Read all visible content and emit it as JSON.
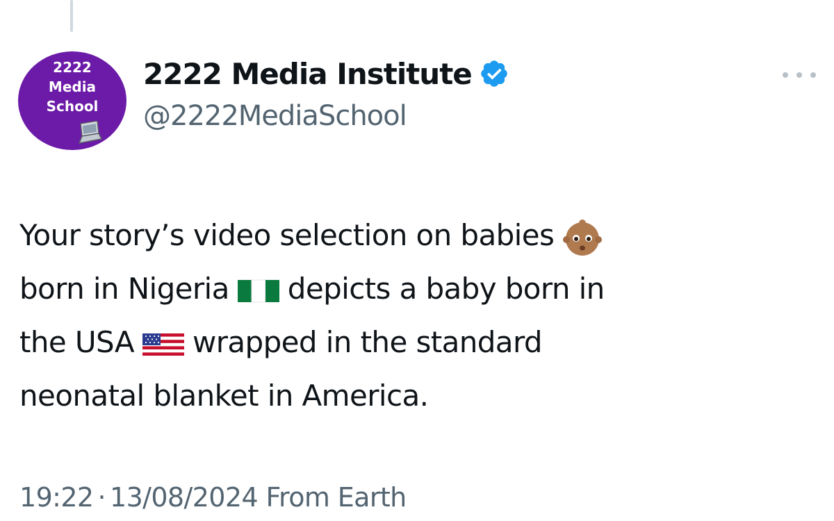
{
  "author": {
    "avatar_lines": [
      "2222",
      "Media",
      "School"
    ],
    "display_name": "2222 Media Institute",
    "handle": "@2222MediaSchool",
    "verified_icon": "verified-badge-icon",
    "avatar_color": "#6c1aa8",
    "verified_color": "#1d9bf0"
  },
  "tweet": {
    "lines": [
      {
        "before": "Your story’s video selection on babies",
        "emoji": "baby",
        "after": ""
      },
      {
        "before": "born in Nigeria",
        "emoji": "flag-nigeria",
        "after": "depicts a baby born in"
      },
      {
        "before": "the USA",
        "emoji": "flag-usa",
        "after": "wrapped in the standard"
      },
      {
        "before": "neonatal blanket in America.",
        "emoji": "",
        "after": ""
      }
    ]
  },
  "meta": {
    "time": "19:22",
    "separator": "·",
    "date": "13/08/2024",
    "source": "From Earth"
  },
  "actions": {
    "more_icon": "more-horizontal-icon"
  },
  "colors": {
    "text": "#0f1419",
    "secondary": "#536471"
  }
}
